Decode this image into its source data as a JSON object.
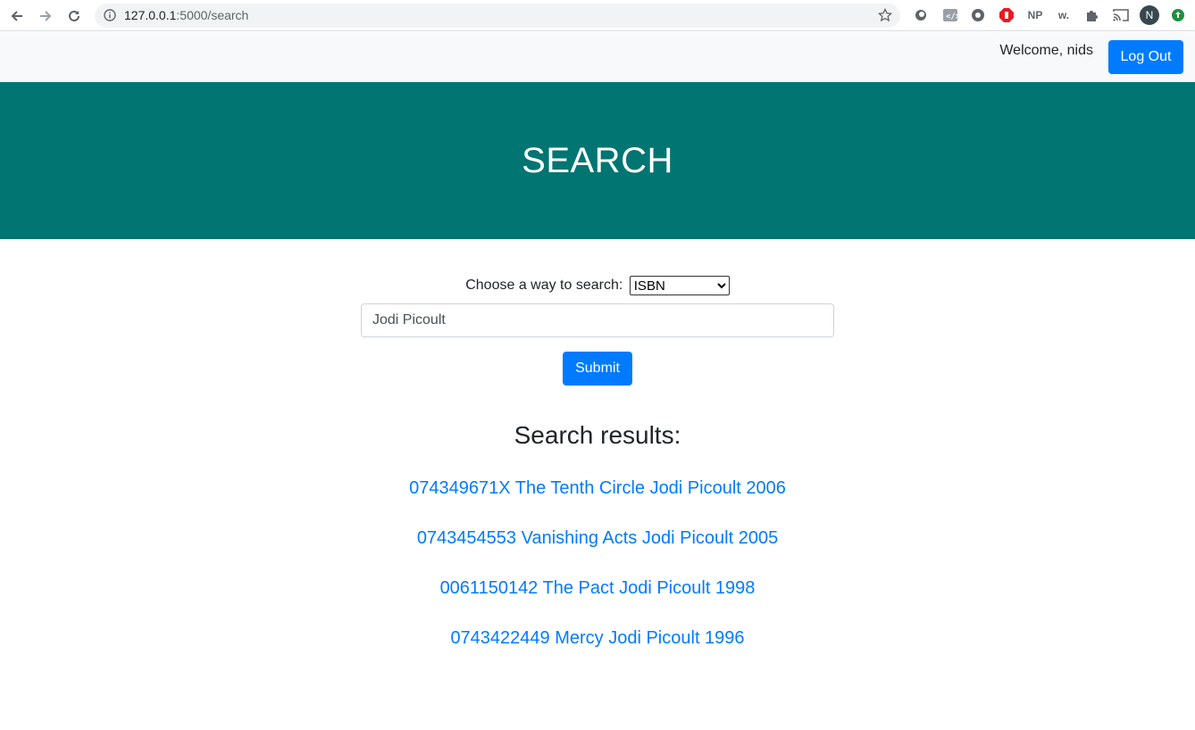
{
  "browser": {
    "url_host": "127.0.0.1",
    "url_rest": ":5000/search",
    "extensions": [
      "circle-icon",
      "code-icon",
      "film-icon",
      "adblock-icon",
      "NP",
      "w.",
      "puzzle-icon",
      "cast-icon",
      "N",
      "update-icon"
    ]
  },
  "navbar": {
    "welcome": "Welcome, nids",
    "logout_label": "Log Out"
  },
  "hero": {
    "title": "SEARCH"
  },
  "form": {
    "label": "Choose a way to search:",
    "select_value": "ISBN",
    "input_value": "Jodi Picoult",
    "submit_label": "Submit"
  },
  "results": {
    "title": "Search results:",
    "items": [
      "074349671X The Tenth Circle Jodi Picoult 2006",
      "0743454553 Vanishing Acts Jodi Picoult 2005",
      "0061150142 The Pact Jodi Picoult 1998",
      "0743422449 Mercy Jodi Picoult 1996"
    ]
  },
  "colors": {
    "hero_bg": "#007571",
    "primary": "#007bff",
    "navbar_bg": "#f8f9fa"
  }
}
